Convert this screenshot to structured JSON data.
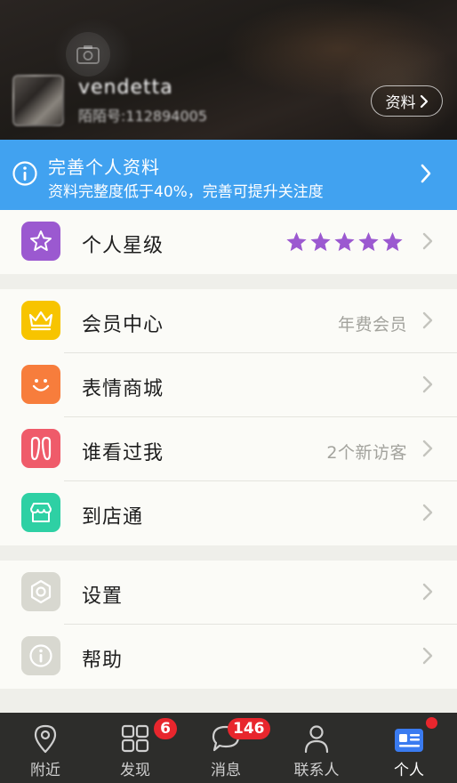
{
  "header": {
    "username": "vendetta",
    "user_id": "陌陌号:112894005",
    "profile_button_label": "资料"
  },
  "banner": {
    "title": "完善个人资料",
    "subtitle": "资料完整度低于40%，完善可提升关注度"
  },
  "sections": {
    "star_level": {
      "label": "个人星级",
      "stars": 5,
      "icon": "star-icon",
      "color": "#9b59d0"
    },
    "vip": {
      "label": "会员中心",
      "value": "年费会员",
      "icon": "crown-icon",
      "color": "#f7c400"
    },
    "emoji": {
      "label": "表情商城",
      "icon": "smile-icon",
      "color": "#f77d3c"
    },
    "visitors": {
      "label": "谁看过我",
      "value": "2个新访客",
      "icon": "footprint-icon",
      "color": "#ef5b6a"
    },
    "store": {
      "label": "到店通",
      "icon": "store-icon",
      "color": "#2ed0a4"
    },
    "settings": {
      "label": "设置",
      "icon": "gear-icon",
      "color": "#d8d8d0"
    },
    "help": {
      "label": "帮助",
      "icon": "info-icon",
      "color": "#d8d8d0"
    }
  },
  "tabbar": {
    "tabs": [
      {
        "label": "附近",
        "icon": "location-pin-icon"
      },
      {
        "label": "发现",
        "icon": "grid-icon",
        "badge": "6"
      },
      {
        "label": "消息",
        "icon": "chat-bubble-icon",
        "badge": "146"
      },
      {
        "label": "联系人",
        "icon": "person-icon"
      },
      {
        "label": "个人",
        "icon": "profile-card-icon",
        "active": true
      }
    ]
  }
}
